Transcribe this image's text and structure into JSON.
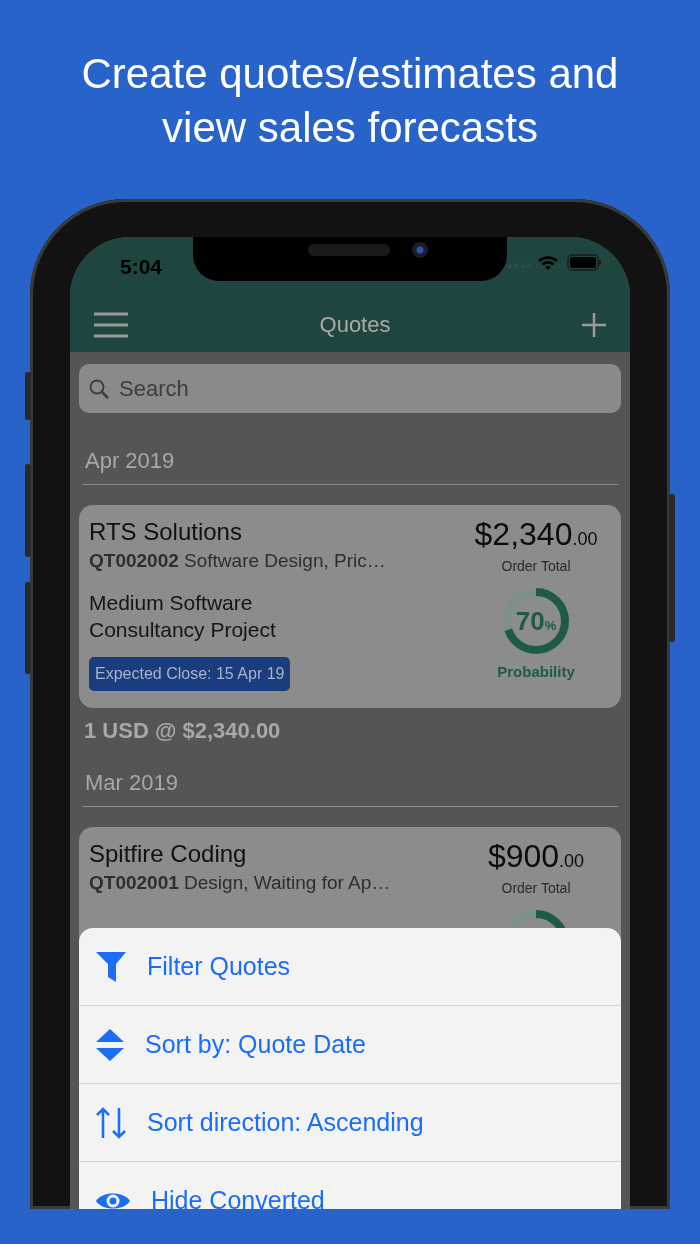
{
  "headline": "Create quotes/estimates and view sales forecasts",
  "status_bar": {
    "time": "5:04"
  },
  "nav_bar": {
    "title": "Quotes"
  },
  "search": {
    "placeholder": "Search"
  },
  "sections": [
    {
      "header": "Apr 2019",
      "footer": "1 USD @ $2,340.00",
      "quotes": [
        {
          "customer": "RTS Solutions",
          "number": "QT002002",
          "description": "Software Design, Pric…",
          "project": "Medium Software Consultancy Project",
          "expected_close": "Expected Close: 15 Apr 19",
          "amount": "$2,340",
          "cents": ".00",
          "total_label": "Order Total",
          "probability": "70",
          "percent": "%",
          "level": 0.7,
          "probability_label": "Probability"
        }
      ]
    },
    {
      "header": "Mar 2019",
      "quotes": [
        {
          "customer": "Spitfire Coding",
          "number": "QT002001",
          "description": "Design, Waiting for Ap…",
          "amount": "$900",
          "cents": ".00",
          "total_label": "Order Total",
          "probability_ring": true
        }
      ]
    }
  ],
  "action_sheet": [
    {
      "kind": "filter",
      "label": "Filter Quotes"
    },
    {
      "kind": "sort",
      "label": "Sort by: Quote Date"
    },
    {
      "kind": "direction",
      "label": "Sort direction: Ascending"
    },
    {
      "kind": "eye",
      "label": "Hide Converted"
    }
  ]
}
